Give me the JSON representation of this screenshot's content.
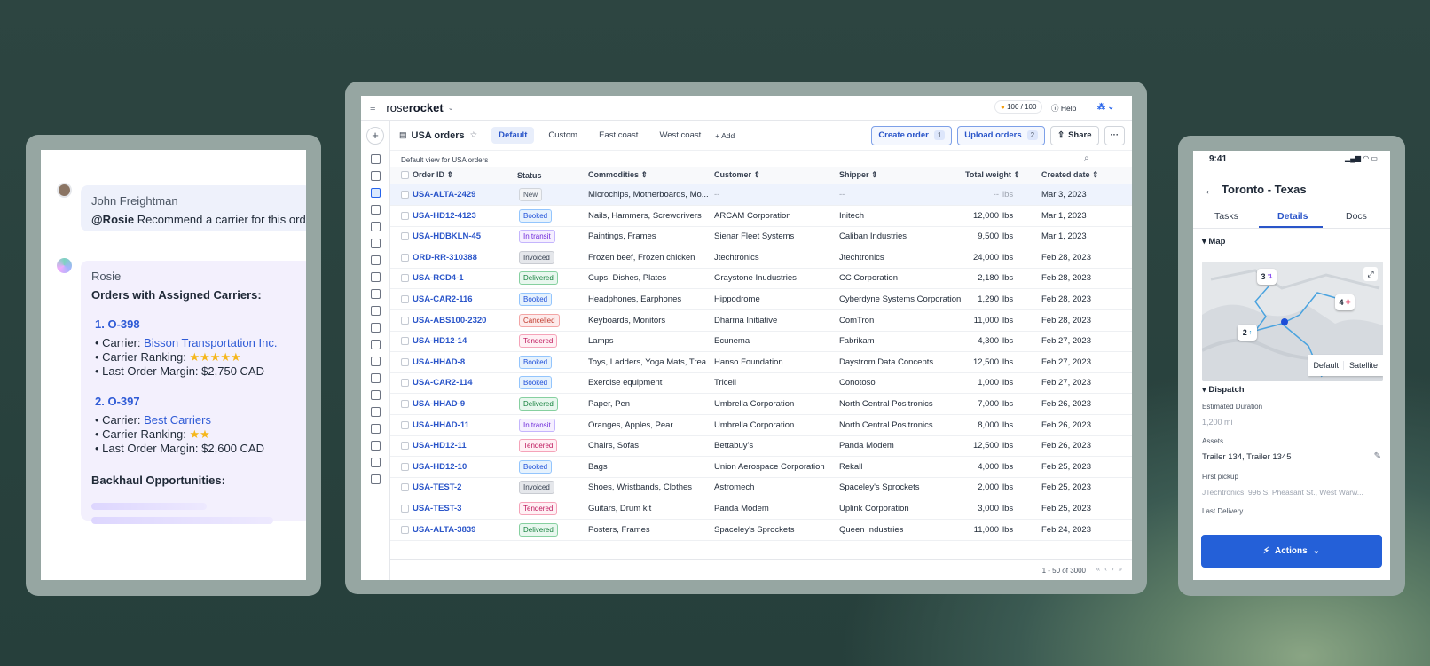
{
  "chat": {
    "john": {
      "name": "John Freightman",
      "mention": "@Rosie",
      "text": " Recommend a carrier for this order"
    },
    "rosie": {
      "name": "Rosie",
      "heading": "Orders with Assigned Carriers:",
      "orders": [
        {
          "label": "1. O-398",
          "carrier_prefix": "Carrier: ",
          "carrier": "Bisson Transportation Inc.",
          "ranking_label": "Carrier Ranking: ",
          "stars": "★★★★★",
          "margin_label": "Last Order Margin: ",
          "margin": "$2,750 CAD"
        },
        {
          "label": "2. O-397",
          "carrier_prefix": "Carrier: ",
          "carrier": "Best Carriers",
          "ranking_label": "Carrier Ranking: ",
          "stars": "★★",
          "margin_label": "Last Order Margin: ",
          "margin": "$2,600 CAD"
        }
      ],
      "backhaul": "Backhaul Opportunities:"
    }
  },
  "app": {
    "brand_a": "rose",
    "brand_b": "rocket",
    "credits": "100 / 100",
    "help": "Help",
    "page_title": "USA orders",
    "tabs": [
      "Default",
      "Custom",
      "East coast",
      "West coast"
    ],
    "add_tab": "Add",
    "create_order": "Create order",
    "create_count": "1",
    "upload_orders": "Upload orders",
    "upload_count": "2",
    "share": "Share",
    "more": "···",
    "view_caption": "Default view for USA orders",
    "columns": [
      "Order ID",
      "Status",
      "Commodities",
      "Customer",
      "Shipper",
      "Total weight",
      "Created date"
    ],
    "rows": [
      {
        "id": "USA-ALTA-2429",
        "status": "New",
        "commodities": "Microchips, Motherboards, Mo...",
        "customer": "--",
        "shipper": "--",
        "weight": "--",
        "unit": "lbs",
        "date": "Mar 3, 2023"
      },
      {
        "id": "USA-HD12-4123",
        "status": "Booked",
        "commodities": "Nails, Hammers, Screwdrivers",
        "customer": "ARCAM Corporation",
        "shipper": "Initech",
        "weight": "12,000",
        "unit": "lbs",
        "date": "Mar 1, 2023"
      },
      {
        "id": "USA-HDBKLN-45",
        "status": "In transit",
        "commodities": "Paintings, Frames",
        "customer": "Sienar Fleet Systems",
        "shipper": "Caliban Industries",
        "weight": "9,500",
        "unit": "lbs",
        "date": "Mar 1, 2023"
      },
      {
        "id": "ORD-RR-310388",
        "status": "Invoiced",
        "commodities": "Frozen beef, Frozen chicken",
        "customer": "Jtechtronics",
        "shipper": "Jtechtronics",
        "weight": "24,000",
        "unit": "lbs",
        "date": "Feb 28, 2023"
      },
      {
        "id": "USA-RCD4-1",
        "status": "Delivered",
        "commodities": "Cups, Dishes, Plates",
        "customer": "Graystone Inudustries",
        "shipper": "CC Corporation",
        "weight": "2,180",
        "unit": "lbs",
        "date": "Feb 28, 2023"
      },
      {
        "id": "USA-CAR2-116",
        "status": "Booked",
        "commodities": "Headphones, Earphones",
        "customer": "Hippodrome",
        "shipper": "Cyberdyne Systems Corporation",
        "weight": "1,290",
        "unit": "lbs",
        "date": "Feb 28, 2023"
      },
      {
        "id": "USA-ABS100-2320",
        "status": "Cancelled",
        "commodities": "Keyboards, Monitors",
        "customer": "Dharma Initiative",
        "shipper": "ComTron",
        "weight": "11,000",
        "unit": "lbs",
        "date": "Feb 28, 2023"
      },
      {
        "id": "USA-HD12-14",
        "status": "Tendered",
        "commodities": "Lamps",
        "customer": "Ecunema",
        "shipper": "Fabrikam",
        "weight": "4,300",
        "unit": "lbs",
        "date": "Feb 27, 2023"
      },
      {
        "id": "USA-HHAD-8",
        "status": "Booked",
        "commodities": "Toys, Ladders, Yoga Mats, Trea...",
        "customer": "Hanso Foundation",
        "shipper": "Daystrom Data Concepts",
        "weight": "12,500",
        "unit": "lbs",
        "date": "Feb 27, 2023"
      },
      {
        "id": "USA-CAR2-114",
        "status": "Booked",
        "commodities": "Exercise equipment",
        "customer": "Tricell",
        "shipper": "Conotoso",
        "weight": "1,000",
        "unit": "lbs",
        "date": "Feb 27, 2023"
      },
      {
        "id": "USA-HHAD-9",
        "status": "Delivered",
        "commodities": "Paper, Pen",
        "customer": "Umbrella Corporation",
        "shipper": "North Central Positronics",
        "weight": "7,000",
        "unit": "lbs",
        "date": "Feb 26, 2023"
      },
      {
        "id": "USA-HHAD-11",
        "status": "In transit",
        "commodities": "Oranges, Apples, Pear",
        "customer": "Umbrella Corporation",
        "shipper": "North Central Positronics",
        "weight": "8,000",
        "unit": "lbs",
        "date": "Feb 26, 2023"
      },
      {
        "id": "USA-HD12-11",
        "status": "Tendered",
        "commodities": "Chairs, Sofas",
        "customer": "Bettabuy's",
        "shipper": "Panda Modem",
        "weight": "12,500",
        "unit": "lbs",
        "date": "Feb 26, 2023"
      },
      {
        "id": "USA-HD12-10",
        "status": "Booked",
        "commodities": "Bags",
        "customer": "Union Aerospace Corporation",
        "shipper": "Rekall",
        "weight": "4,000",
        "unit": "lbs",
        "date": "Feb 25, 2023"
      },
      {
        "id": "USA-TEST-2",
        "status": "Invoiced",
        "commodities": "Shoes, Wristbands, Clothes",
        "customer": "Astromech",
        "shipper": "Spaceley's Sprockets",
        "weight": "2,000",
        "unit": "lbs",
        "date": "Feb 25, 2023"
      },
      {
        "id": "USA-TEST-3",
        "status": "Tendered",
        "commodities": "Guitars, Drum kit",
        "customer": "Panda Modem",
        "shipper": "Uplink Corporation",
        "weight": "3,000",
        "unit": "lbs",
        "date": "Feb 25, 2023"
      },
      {
        "id": "USA-ALTA-3839",
        "status": "Delivered",
        "commodities": "Posters, Frames",
        "customer": "Spaceley's Sprockets",
        "shipper": "Queen Industries",
        "weight": "11,000",
        "unit": "lbs",
        "date": "Feb 24, 2023"
      }
    ],
    "pagination": "1 - 50 of 3000"
  },
  "mobile": {
    "time": "9:41",
    "title": "Toronto - Texas",
    "tabs": [
      "Tasks",
      "Details",
      "Docs"
    ],
    "map_section": "Map",
    "map_default": "Default",
    "map_satellite": "Satellite",
    "pins": [
      "3",
      "4",
      "2"
    ],
    "dispatch_section": "Dispatch",
    "est_label": "Estimated Duration",
    "est_value": "1,200 mi",
    "assets_label": "Assets",
    "assets_value": "Trailer 134, Trailer 1345",
    "pickup_label": "First pickup",
    "pickup_value": "JTechtronics, 996 S. Pheasant St., West Warw...",
    "delivery_label": "Last Delivery",
    "actions": "Actions"
  },
  "colors": {
    "accent": "#2460d8",
    "background": "#2a4440",
    "frame": "#96a6a2"
  }
}
